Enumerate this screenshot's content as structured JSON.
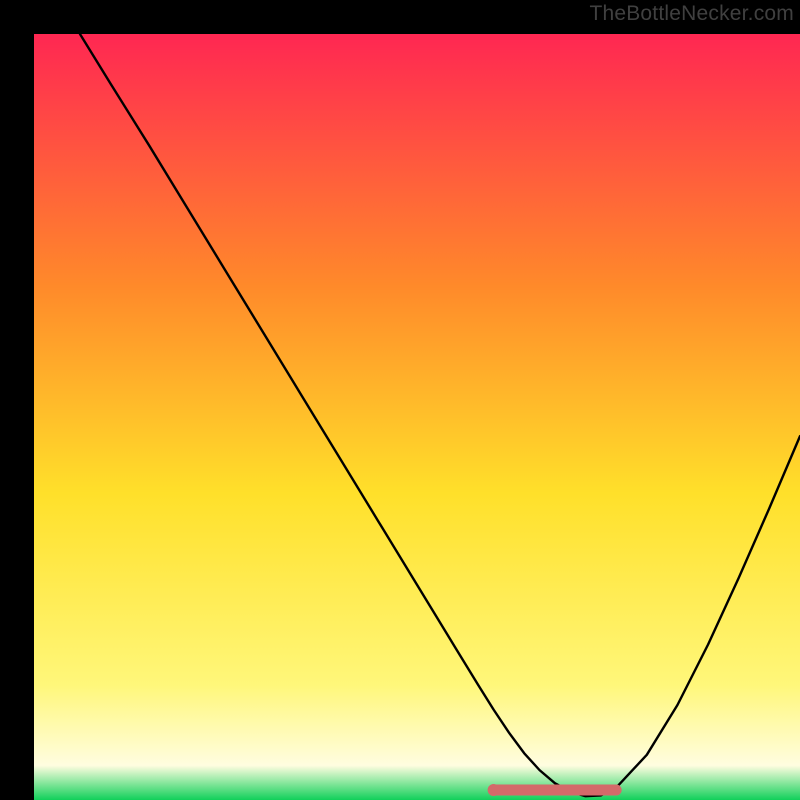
{
  "watermark": "TheBottleNecker.com",
  "chart_data": {
    "type": "line",
    "title": "",
    "xlabel": "",
    "ylabel": "",
    "xlim": [
      0,
      100
    ],
    "ylim": [
      0,
      100
    ],
    "gradient_colors": {
      "top": "#ff2752",
      "upper_mid": "#ff8a2a",
      "mid": "#ffe02a",
      "lower_mid": "#fff77a",
      "band": "#fffde0",
      "bottom": "#11d05a"
    },
    "series": [
      {
        "name": "bottleneck-curve",
        "color": "#000000",
        "x": [
          6,
          10,
          15,
          20,
          25,
          30,
          35,
          40,
          45,
          50,
          55,
          58,
          60,
          62,
          64,
          66,
          68,
          70,
          72,
          74,
          76,
          80,
          84,
          88,
          92,
          96,
          100
        ],
        "y": [
          100,
          93.5,
          85.5,
          77.3,
          69.1,
          60.9,
          52.7,
          44.5,
          36.3,
          28.1,
          19.9,
          15.0,
          11.8,
          8.8,
          6.1,
          3.9,
          2.2,
          1.1,
          0.5,
          0.6,
          1.6,
          5.9,
          12.4,
          20.3,
          29.0,
          38.1,
          47.5
        ]
      }
    ],
    "flat_segment": {
      "color": "#d46a6a",
      "x_start": 60,
      "x_end": 76,
      "y": 1.3,
      "endpoint_radius_left": 6,
      "endpoint_radius_right": 5
    }
  }
}
